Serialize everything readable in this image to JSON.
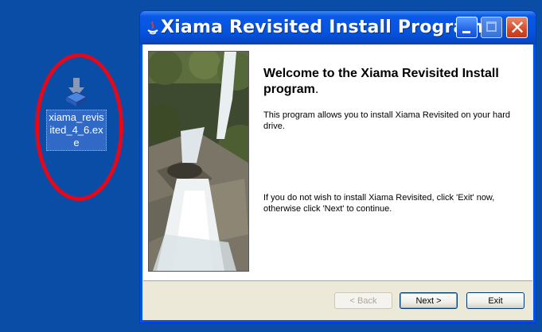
{
  "desktop": {
    "icon_label": "xiama_revisited_4_6.exe",
    "icon": "installer-download-icon",
    "highlight_color": "#e3081a"
  },
  "window": {
    "title": "Xiama Revisited Install Program",
    "title_icon": "java-installer-icon",
    "controls": [
      "minimize-icon",
      "maximize-icon",
      "close-icon"
    ],
    "close_glyph": "✕"
  },
  "content": {
    "welcome_heading": "Welcome to the Xiama Revisited Install program",
    "welcome_period": ".",
    "intro_text": "This program allows you to install Xiama Revisited on your hard drive.",
    "instruction_text": "If you do not wish to install Xiama Revisited, click 'Exit' now, otherwise click 'Next' to continue.",
    "image": "waterfall-photo"
  },
  "buttons": {
    "back": "< Back",
    "next": "Next >",
    "exit": "Exit"
  },
  "colors": {
    "desktop": "#0a4da6",
    "titlebar": "#0554e0",
    "close_button": "#d64a28"
  }
}
